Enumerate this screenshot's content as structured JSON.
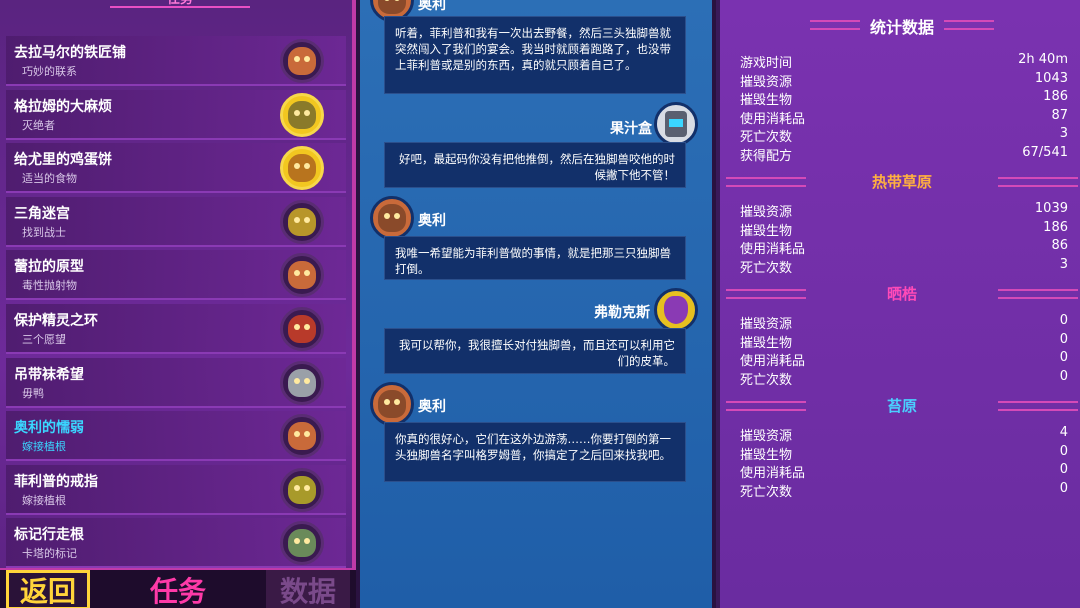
{
  "left": {
    "header": "任务",
    "quests": [
      {
        "title": "去拉马尔的铁匠铺",
        "sub": "巧妙的联系",
        "face": "#c96a3a",
        "gold": false,
        "active": false
      },
      {
        "title": "格拉姆的大麻烦",
        "sub": "灭绝者",
        "face": "#8a7a2a",
        "gold": true,
        "active": false
      },
      {
        "title": "给尤里的鸡蛋饼",
        "sub": "适当的食物",
        "face": "#b8741e",
        "gold": true,
        "active": false
      },
      {
        "title": "三角迷宫",
        "sub": "找到战士",
        "face": "#b8962a",
        "gold": false,
        "active": false
      },
      {
        "title": "蕾拉的原型",
        "sub": "毒性抛射物",
        "face": "#c96a3a",
        "gold": false,
        "active": false
      },
      {
        "title": "保护精灵之环",
        "sub": "三个愿望",
        "face": "#b83a2a",
        "gold": false,
        "active": false
      },
      {
        "title": "吊带袜希望",
        "sub": "毋鸭",
        "face": "#9aa0a8",
        "gold": false,
        "active": false
      },
      {
        "title": "奥利的懦弱",
        "sub": "嫁接植根",
        "face": "#c96a3a",
        "gold": false,
        "active": true
      },
      {
        "title": "菲利普的戒指",
        "sub": "嫁接植根",
        "face": "#a89a2a",
        "gold": false,
        "active": false
      },
      {
        "title": "标记行走根",
        "sub": "卡塔的标记",
        "face": "#6a8a5a",
        "gold": false,
        "active": false
      }
    ]
  },
  "nav": {
    "back": "返回",
    "quest": "任务",
    "stats": "数据"
  },
  "dialog": {
    "speaker1": "奥利",
    "msg1": "听着，菲利普和我有一次出去野餐，然后三头独脚兽就突然闯入了我们的宴会。我当时就顾着跑路了，也没带上菲利普或是别的东西，真的就只顾着自己了。",
    "speaker2": "果汁盒",
    "msg2": "好吧，最起码你没有把他推倒，然后在独脚兽咬他的时候撇下他不管！",
    "speaker3": "奥利",
    "msg3": "我唯一希望能为菲利普做的事情，就是把那三只独脚兽打倒。",
    "speaker4": "弗勒克斯",
    "msg4": "我可以帮你，我很擅长对付独脚兽，而且还可以利用它们的皮革。",
    "speaker5": "奥利",
    "msg5": "你真的很好心，它们在这外边游荡……你要打倒的第一头独脚兽名字叫格罗姆普，你搞定了之后回来找我吧。"
  },
  "stats": {
    "title": "统计数据",
    "general": [
      {
        "k": "游戏时间",
        "v": "2h 40m"
      },
      {
        "k": "摧毁资源",
        "v": "1043"
      },
      {
        "k": "摧毁生物",
        "v": "186"
      },
      {
        "k": "使用消耗品",
        "v": "87"
      },
      {
        "k": "死亡次数",
        "v": "3"
      },
      {
        "k": "获得配方",
        "v": "67/541"
      }
    ],
    "sections": [
      {
        "name": "热带草原",
        "color": "#ffb040",
        "rows": [
          {
            "k": "摧毁资源",
            "v": "1039"
          },
          {
            "k": "摧毁生物",
            "v": "186"
          },
          {
            "k": "使用消耗品",
            "v": "86"
          },
          {
            "k": "死亡次数",
            "v": "3"
          }
        ]
      },
      {
        "name": "晒梏",
        "color": "#ff4ab8",
        "rows": [
          {
            "k": "摧毁资源",
            "v": "0"
          },
          {
            "k": "摧毁生物",
            "v": "0"
          },
          {
            "k": "使用消耗品",
            "v": "0"
          },
          {
            "k": "死亡次数",
            "v": "0"
          }
        ]
      },
      {
        "name": "苔原",
        "color": "#4ad0ff",
        "rows": [
          {
            "k": "摧毁资源",
            "v": "4"
          },
          {
            "k": "摧毁生物",
            "v": "0"
          },
          {
            "k": "使用消耗品",
            "v": "0"
          },
          {
            "k": "死亡次数",
            "v": "0"
          }
        ]
      }
    ]
  }
}
